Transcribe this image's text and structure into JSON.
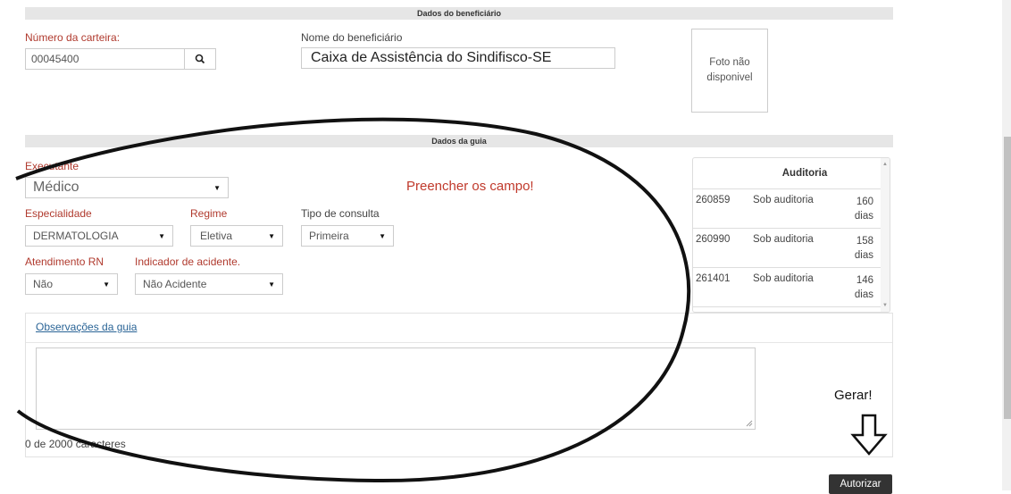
{
  "beneficiario": {
    "section_title": "Dados do beneficiário",
    "carteira_label": "Número da carteira:",
    "carteira_value": "00045400",
    "nome_label": "Nome do beneficiário",
    "nome_value": "Caixa de Assistência do Sindifisco-SE",
    "foto_text": "Foto não disponivel"
  },
  "guia": {
    "section_title": "Dados da guia",
    "executante_label": "Executante",
    "executante_value": "Médico",
    "especialidade_label": "Especialidade",
    "especialidade_value": "DERMATOLOGIA",
    "regime_label": "Regime",
    "regime_value": "Eletiva",
    "tipo_label": "Tipo de consulta",
    "tipo_value": "Primeira",
    "rn_label": "Atendimento RN",
    "rn_value": "Não",
    "acidente_label": "Indicador de acidente.",
    "acidente_value": "Não Acidente"
  },
  "annotation": {
    "preencher": "Preencher os campo!",
    "gerar": "Gerar!"
  },
  "auditoria": {
    "title": "Auditoria",
    "rows": [
      {
        "id": "260859",
        "status": "Sob auditoria",
        "days": "160",
        "unit": "dias"
      },
      {
        "id": "260990",
        "status": "Sob auditoria",
        "days": "158",
        "unit": "dias"
      },
      {
        "id": "261401",
        "status": "Sob auditoria",
        "days": "146",
        "unit": "dias"
      }
    ]
  },
  "observacoes": {
    "link": "Observações da guia",
    "counter": "0 de 2000 caracteres"
  },
  "actions": {
    "autorizar": "Autorizar"
  },
  "icons": [
    "search-icon",
    "caret-down-icon",
    "arrow-down-icon",
    "resize-handle-icon"
  ]
}
